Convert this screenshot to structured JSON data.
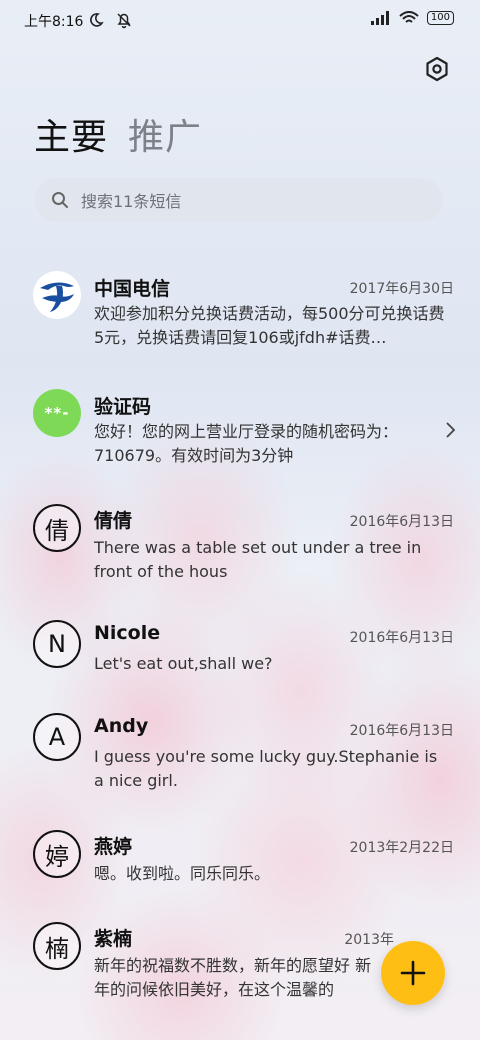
{
  "status_bar": {
    "time": "上午8:16",
    "left_icons": [
      "moon-icon",
      "mute-bell-icon"
    ],
    "right_icons": [
      "signal-icon",
      "wifi-icon",
      "battery-icon"
    ],
    "battery": "100"
  },
  "tabs": [
    {
      "label": "主要",
      "active": true
    },
    {
      "label": "推广",
      "active": false
    }
  ],
  "search": {
    "placeholder": "搜索11条短信"
  },
  "conversations": [
    {
      "name": "中国电信",
      "date": "2017年6月30日",
      "preview": "欢迎参加积分兑换话费活动，每500分可兑换话费5元，兑换话费请回复106或jfdh#话费…",
      "avatar": "telecom-logo"
    },
    {
      "name": "验证码",
      "date": "",
      "preview": "您好！您的网上营业厅登录的随机密码为：710679。有效时间为3分钟",
      "avatar": "**-"
    },
    {
      "name": "倩倩",
      "date": "2016年6月13日",
      "preview": "There was a table set out under a tree in front of the hous",
      "avatar": "倩"
    },
    {
      "name": "Nicole",
      "date": "2016年6月13日",
      "preview": "Let's eat out,shall we?",
      "avatar": "N"
    },
    {
      "name": "Andy",
      "date": "2016年6月13日",
      "preview": "I guess you're some lucky guy.Stephanie is a nice girl.",
      "avatar": "A"
    },
    {
      "name": "燕婷",
      "date": "2013年2月22日",
      "preview": "嗯。收到啦。同乐同乐。",
      "avatar": "婷"
    },
    {
      "name": "紫楠",
      "date": "2013年",
      "preview": "新年的祝福数不胜数，新年的愿望好 新年的问候依旧美好，在这个温馨的",
      "avatar": "楠"
    }
  ],
  "fab": {
    "label": "+"
  },
  "colors": {
    "accent": "#ffbe14",
    "code_avatar": "#7ed957",
    "telecom_blue": "#1a4fa0"
  }
}
